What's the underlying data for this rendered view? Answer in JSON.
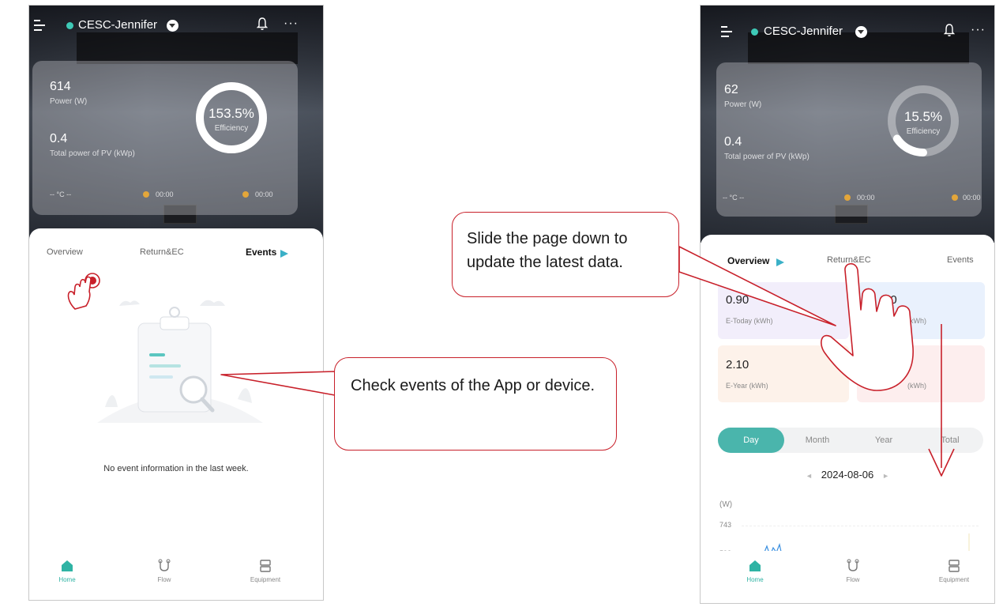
{
  "left_phone": {
    "station_name": "CESC-Jennifer",
    "power_value": "614",
    "power_label": "Power (W)",
    "pv_value": "0.4",
    "pv_label": "Total power of PV (kWp)",
    "efficiency_value": "153.5%",
    "efficiency_label": "Efficiency",
    "efficiency_ratio": 1.0,
    "temperature": "-- °C --",
    "sunrise": "00:00",
    "sunset": "00:00",
    "tabs": [
      "Overview",
      "Return&EC",
      "Events"
    ],
    "active_tab": "Events",
    "empty_message": "No event information in the last week.",
    "nav": [
      "Home",
      "Flow",
      "Equipment"
    ]
  },
  "right_phone": {
    "station_name": "CESC-Jennifer",
    "power_value": "62",
    "power_label": "Power (W)",
    "pv_value": "0.4",
    "pv_label": "Total power of PV (kWp)",
    "efficiency_value": "15.5%",
    "efficiency_label": "Efficiency",
    "efficiency_ratio": 0.155,
    "temperature": "-- °C --",
    "sunrise": "00:00",
    "sunset": "00:00",
    "tabs": [
      "Overview",
      "Return&EC",
      "Events"
    ],
    "active_tab": "Overview",
    "cards": [
      {
        "value": "0.90",
        "label": "E-Today (kWh)"
      },
      {
        "value": "10",
        "label": "(kWh)"
      },
      {
        "value": "2.10",
        "label": "E-Year (kWh)"
      },
      {
        "value": "",
        "label": "(kWh)"
      }
    ],
    "periods": [
      "Day",
      "Month",
      "Year",
      "Total"
    ],
    "active_period": "Day",
    "date": "2024-08-06",
    "chart_unit": "(W)",
    "y_ticks": [
      "743",
      "592"
    ],
    "nav": [
      "Home",
      "Flow",
      "Equipment"
    ]
  },
  "callouts": {
    "events_tip": "Check events of the App or device.",
    "refresh_tip": "Slide the page down to update the latest data."
  },
  "colors": {
    "accent": "#4ab5ac",
    "callout_border": "#c8202a",
    "status_dot": "#3ec9b6"
  }
}
